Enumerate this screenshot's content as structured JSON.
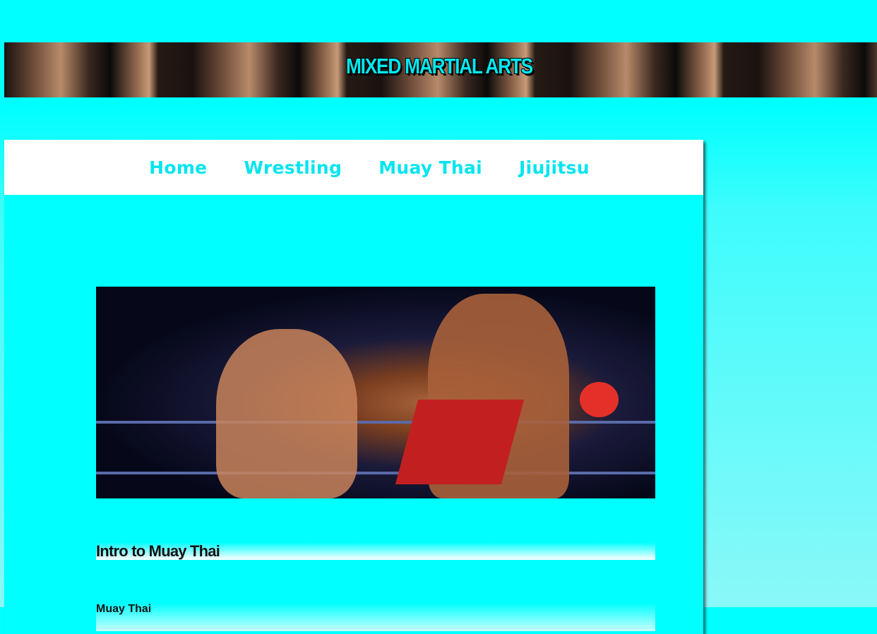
{
  "banner": {
    "title": "MIXED MARTIAL ARTS"
  },
  "nav": {
    "items": [
      {
        "label": "Home"
      },
      {
        "label": "Wrestling"
      },
      {
        "label": "Muay Thai"
      },
      {
        "label": "Jiujitsu"
      }
    ]
  },
  "content": {
    "heading": "Intro to Muay Thai",
    "subheading": "Muay Thai"
  },
  "colors": {
    "background": "#00ffff",
    "nav_link": "#00e5f0"
  }
}
